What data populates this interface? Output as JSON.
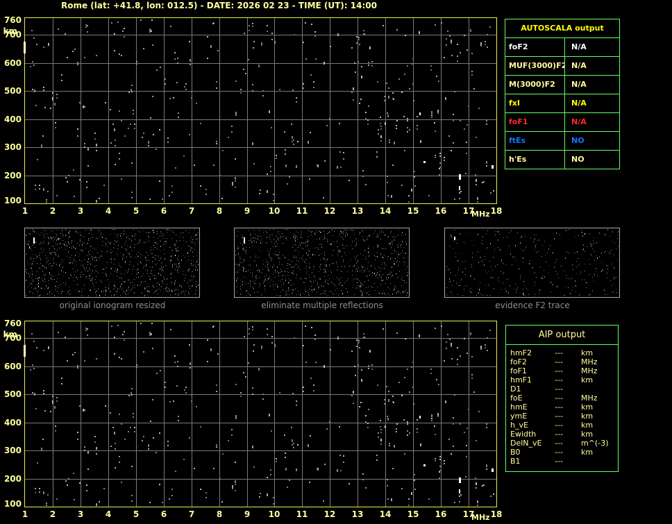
{
  "title": "Rome (lat: +41.8, lon: 012.5) - DATE: 2026 02 23 - TIME (UT): 14:00",
  "colors": {
    "background": "#000000",
    "title_text": "#ffffa0",
    "plot_border": "#ecec5a",
    "grid": "#7a7a7a",
    "axis_text": "#ffff9e",
    "table_border": "#66ff66",
    "autoscala_header": "#ffff00",
    "caption_text": "#8f8f8f",
    "status_red": "#ff2a2a",
    "status_blue": "#1177ff",
    "pale_yellow": "#ffff9e",
    "white": "#ffffff"
  },
  "autoscala_table": {
    "header": "AUTOSCALA output",
    "rows": [
      {
        "label": "foF2",
        "value": "N/A",
        "color": "#ffffff"
      },
      {
        "label": "MUF(3000)F2",
        "value": "N/A",
        "color": "#ffff9e"
      },
      {
        "label": "M(3000)F2",
        "value": "N/A",
        "color": "#ffff9e"
      },
      {
        "label": "fxI",
        "value": "N/A",
        "color": "#ffff00"
      },
      {
        "label": "foF1",
        "value": "N/A",
        "color": "#ff2a2a"
      },
      {
        "label": "ftEs",
        "value": "NO",
        "color": "#1177ff"
      },
      {
        "label": "h'Es",
        "value": "NO",
        "color": "#ffff9e"
      }
    ]
  },
  "aip_table": {
    "header": "AIP output",
    "rows": [
      {
        "label": "hmF2",
        "value": "---",
        "unit": "km"
      },
      {
        "label": "foF2",
        "value": "---",
        "unit": "MHz"
      },
      {
        "label": "foF1",
        "value": "---",
        "unit": "MHz"
      },
      {
        "label": "hmF1",
        "value": "---",
        "unit": "km"
      },
      {
        "label": "D1",
        "value": "---",
        "unit": ""
      },
      {
        "label": "foE",
        "value": "---",
        "unit": "MHz"
      },
      {
        "label": "hmE",
        "value": "---",
        "unit": "km"
      },
      {
        "label": "ymE",
        "value": "---",
        "unit": "km"
      },
      {
        "label": "h_vE",
        "value": "---",
        "unit": "km"
      },
      {
        "label": "Ewidth",
        "value": "---",
        "unit": "km"
      },
      {
        "label": "DelN_vE",
        "value": "---",
        "unit": "m^(-3)"
      },
      {
        "label": "B0",
        "value": "---",
        "unit": "km"
      },
      {
        "label": "B1",
        "value": "---",
        "unit": ""
      }
    ]
  },
  "panels": [
    {
      "caption": "original ionogram resized",
      "noise": {
        "seed": 11,
        "count": 1050,
        "bright_prob": 0.015
      },
      "marks": [
        {
          "fx": 0.048,
          "fy": 0.13,
          "w": 2,
          "h": 9,
          "color": "#ffffff"
        }
      ]
    },
    {
      "caption": "eliminate multiple reflections",
      "noise": {
        "seed": 22,
        "count": 960,
        "bright_prob": 0.015
      },
      "marks": [
        {
          "fx": 0.052,
          "fy": 0.13,
          "w": 2,
          "h": 9,
          "color": "#ffffff"
        }
      ]
    },
    {
      "caption": "evidence F2 trace",
      "noise": {
        "seed": 33,
        "count": 370,
        "bright_prob": 0.02
      },
      "marks": [
        {
          "fx": 0.05,
          "fy": 0.12,
          "w": 2,
          "h": 5,
          "color": "#ffffff"
        }
      ]
    }
  ],
  "chart_data": [
    {
      "id": "top-ionogram",
      "type": "scatter",
      "title": "raw ionogram (echo noise, no trace detected - all parameters N/A)",
      "xlabel": "MHz",
      "ylabel": "km",
      "xlim": [
        1,
        18
      ],
      "ylim": [
        100,
        760
      ],
      "x_ticks": [
        1,
        2,
        3,
        4,
        5,
        6,
        7,
        8,
        9,
        10,
        11,
        12,
        13,
        14,
        15,
        16,
        17,
        18
      ],
      "y_ticks": [
        760,
        700,
        600,
        500,
        400,
        300,
        200,
        100
      ],
      "grid": true,
      "noise": {
        "seed": 20260223,
        "count": 360,
        "chain_prob": 0.28
      },
      "marks": [
        {
          "mhz": 16.64,
          "km": 204,
          "w": 3,
          "h": 8
        },
        {
          "mhz": 16.66,
          "km": 163,
          "w": 2,
          "h": 6
        },
        {
          "mhz": 15.38,
          "km": 252,
          "w": 3,
          "h": 3
        },
        {
          "mhz": 17.83,
          "km": 237,
          "w": 3,
          "h": 5
        },
        {
          "mhz": 15.21,
          "km": 425,
          "w": 2,
          "h": 4
        }
      ],
      "edge_marker": {
        "km_top": 676,
        "km_bottom": 634,
        "color": "#ffffca"
      }
    },
    {
      "id": "bottom-ionogram",
      "type": "scatter",
      "title": "ionogram after processing (same echo noise, no trace detected)",
      "xlabel": "MHz",
      "ylabel": "km",
      "xlim": [
        1,
        18
      ],
      "ylim": [
        100,
        760
      ],
      "x_ticks": [
        1,
        2,
        3,
        4,
        5,
        6,
        7,
        8,
        9,
        10,
        11,
        12,
        13,
        14,
        15,
        16,
        17,
        18
      ],
      "y_ticks": [
        760,
        700,
        600,
        500,
        400,
        300,
        200,
        100
      ],
      "grid": true,
      "noise": {
        "seed": 20260223,
        "count": 360,
        "chain_prob": 0.28
      },
      "marks": [
        {
          "mhz": 16.64,
          "km": 204,
          "w": 3,
          "h": 8
        },
        {
          "mhz": 16.66,
          "km": 163,
          "w": 2,
          "h": 6
        },
        {
          "mhz": 15.38,
          "km": 252,
          "w": 3,
          "h": 3
        },
        {
          "mhz": 17.83,
          "km": 237,
          "w": 3,
          "h": 5
        },
        {
          "mhz": 15.21,
          "km": 425,
          "w": 2,
          "h": 4
        }
      ],
      "edge_marker": {
        "km_top": 676,
        "km_bottom": 634,
        "color": "#ffffca"
      }
    }
  ]
}
